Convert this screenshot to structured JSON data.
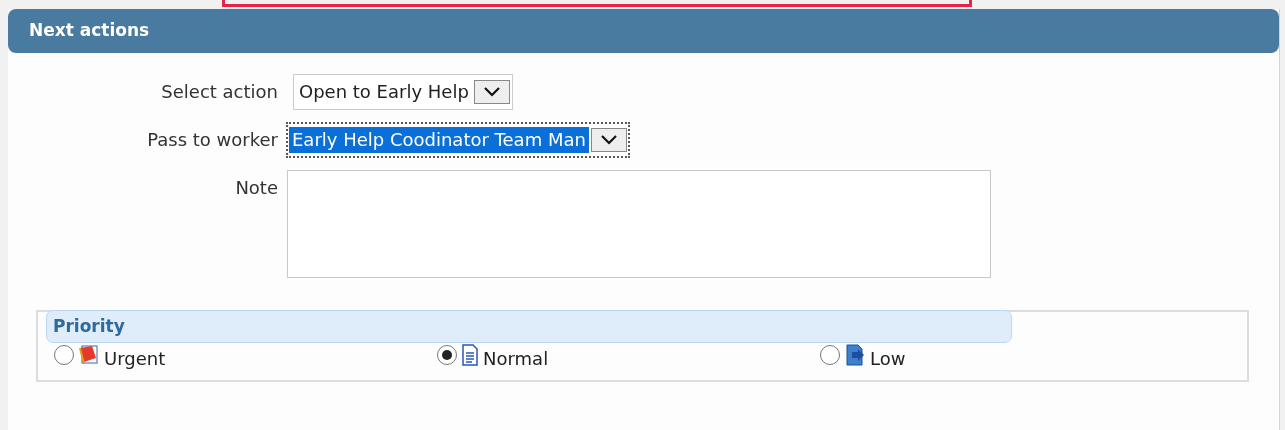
{
  "panel": {
    "title": "Next actions"
  },
  "fields": [
    {
      "kind": "select",
      "label": "Select action",
      "value": "Open to Early Help",
      "focused": false
    },
    {
      "kind": "select",
      "label": "Pass to worker",
      "value": "Early Help Coodinator Team Man",
      "focused": true
    },
    {
      "kind": "textarea",
      "label": "Note"
    }
  ],
  "priority": {
    "legend": "Priority",
    "options": [
      {
        "kind": "urgent",
        "label": "Urgent",
        "selected": false
      },
      {
        "kind": "normal",
        "label": "Normal",
        "selected": true
      },
      {
        "kind": "low",
        "label": "Low",
        "selected": false
      }
    ]
  }
}
